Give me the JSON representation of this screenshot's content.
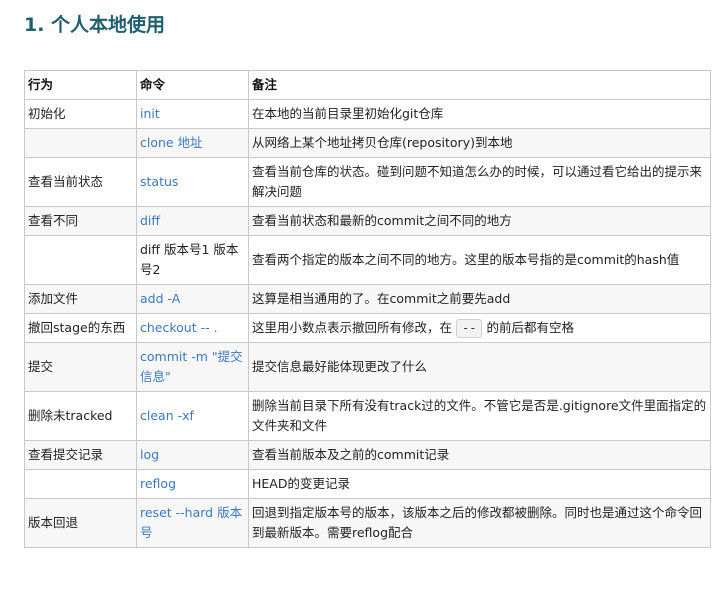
{
  "heading": "1. 个人本地使用",
  "table": {
    "headers": [
      "行为",
      "命令",
      "备注"
    ],
    "rows": [
      {
        "action": "初始化",
        "command": "init",
        "note": "在本地的当前目录里初始化git仓库"
      },
      {
        "action": "",
        "command": "clone 地址",
        "note": "从网络上某个地址拷贝仓库(repository)到本地"
      },
      {
        "action": "查看当前状态",
        "command": "status",
        "note": "查看当前仓库的状态。碰到问题不知道怎么办的时候，可以通过看它给出的提示来解决问题"
      },
      {
        "action": "查看不同",
        "command": "diff",
        "note": "查看当前状态和最新的commit之间不同的地方"
      },
      {
        "action": "",
        "command": "diff 版本号1 版本号2",
        "note": "查看两个指定的版本之间不同的地方。这里的版本号指的是commit的hash值"
      },
      {
        "action": "添加文件",
        "command": "add -A",
        "note": "这算是相当通用的了。在commit之前要先add"
      },
      {
        "action": "撤回stage的东西",
        "command": "checkout -- .",
        "note_pre": "这里用小数点表示撤回所有修改，在",
        "note_code": "--",
        "note_post": "的前后都有空格"
      },
      {
        "action": "提交",
        "command": "commit -m \"提交信息\"",
        "note": "提交信息最好能体现更改了什么"
      },
      {
        "action": "删除未tracked",
        "command": "clean -xf",
        "note": "删除当前目录下所有没有track过的文件。不管它是否是.gitignore文件里面指定的文件夹和文件"
      },
      {
        "action": "查看提交记录",
        "command": "log",
        "note": "查看当前版本及之前的commit记录"
      },
      {
        "action": "",
        "command": "reflog",
        "note": "HEAD的变更记录"
      },
      {
        "action": "版本回退",
        "command": "reset --hard 版本号",
        "note": "回退到指定版本号的版本，该版本之后的修改都被删除。同时也是通过这个命令回到最新版本。需要reflog配合"
      }
    ]
  }
}
